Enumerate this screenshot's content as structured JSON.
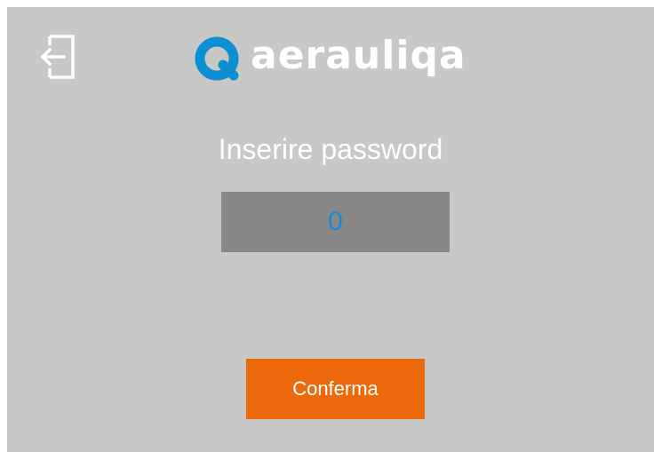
{
  "header": {
    "exit_icon": "exit-door-icon",
    "logo_text": "aerauliqa",
    "logo_icon": "aerauliqa-logo-icon",
    "brand_color": "#0d8fd3"
  },
  "login": {
    "prompt": "Inserire password",
    "password_value": "0",
    "confirm_label": "Conferma"
  },
  "colors": {
    "background": "#c8c8c7",
    "field_background": "#888888",
    "field_text": "#1a8ad6",
    "accent_button": "#ec6a0c",
    "text": "#ffffff"
  }
}
